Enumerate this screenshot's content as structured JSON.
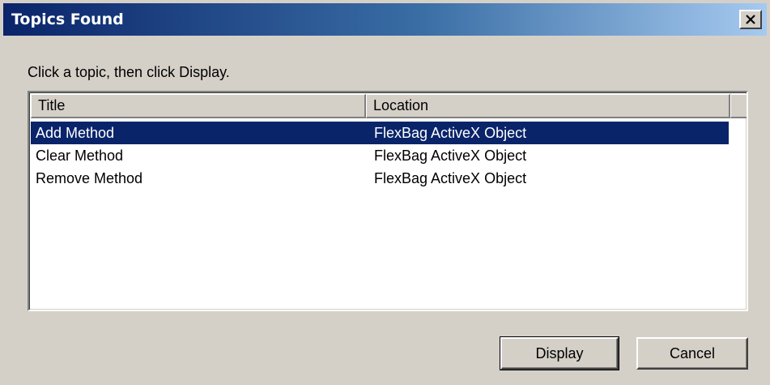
{
  "window": {
    "title": "Topics Found",
    "close_icon": "close-icon"
  },
  "instruction": "Click a topic, then click Display.",
  "list": {
    "columns": [
      "Title",
      "Location"
    ],
    "rows": [
      {
        "title": "Add Method",
        "location": "FlexBag ActiveX Object",
        "selected": true
      },
      {
        "title": "Clear Method",
        "location": "FlexBag ActiveX Object",
        "selected": false
      },
      {
        "title": "Remove Method",
        "location": "FlexBag ActiveX Object",
        "selected": false
      }
    ]
  },
  "buttons": {
    "display": "Display",
    "cancel": "Cancel"
  },
  "colors": {
    "titlebar_start": "#0a246a",
    "titlebar_end": "#a6caf0",
    "selection": "#0a246a",
    "face": "#d4d0c8"
  }
}
